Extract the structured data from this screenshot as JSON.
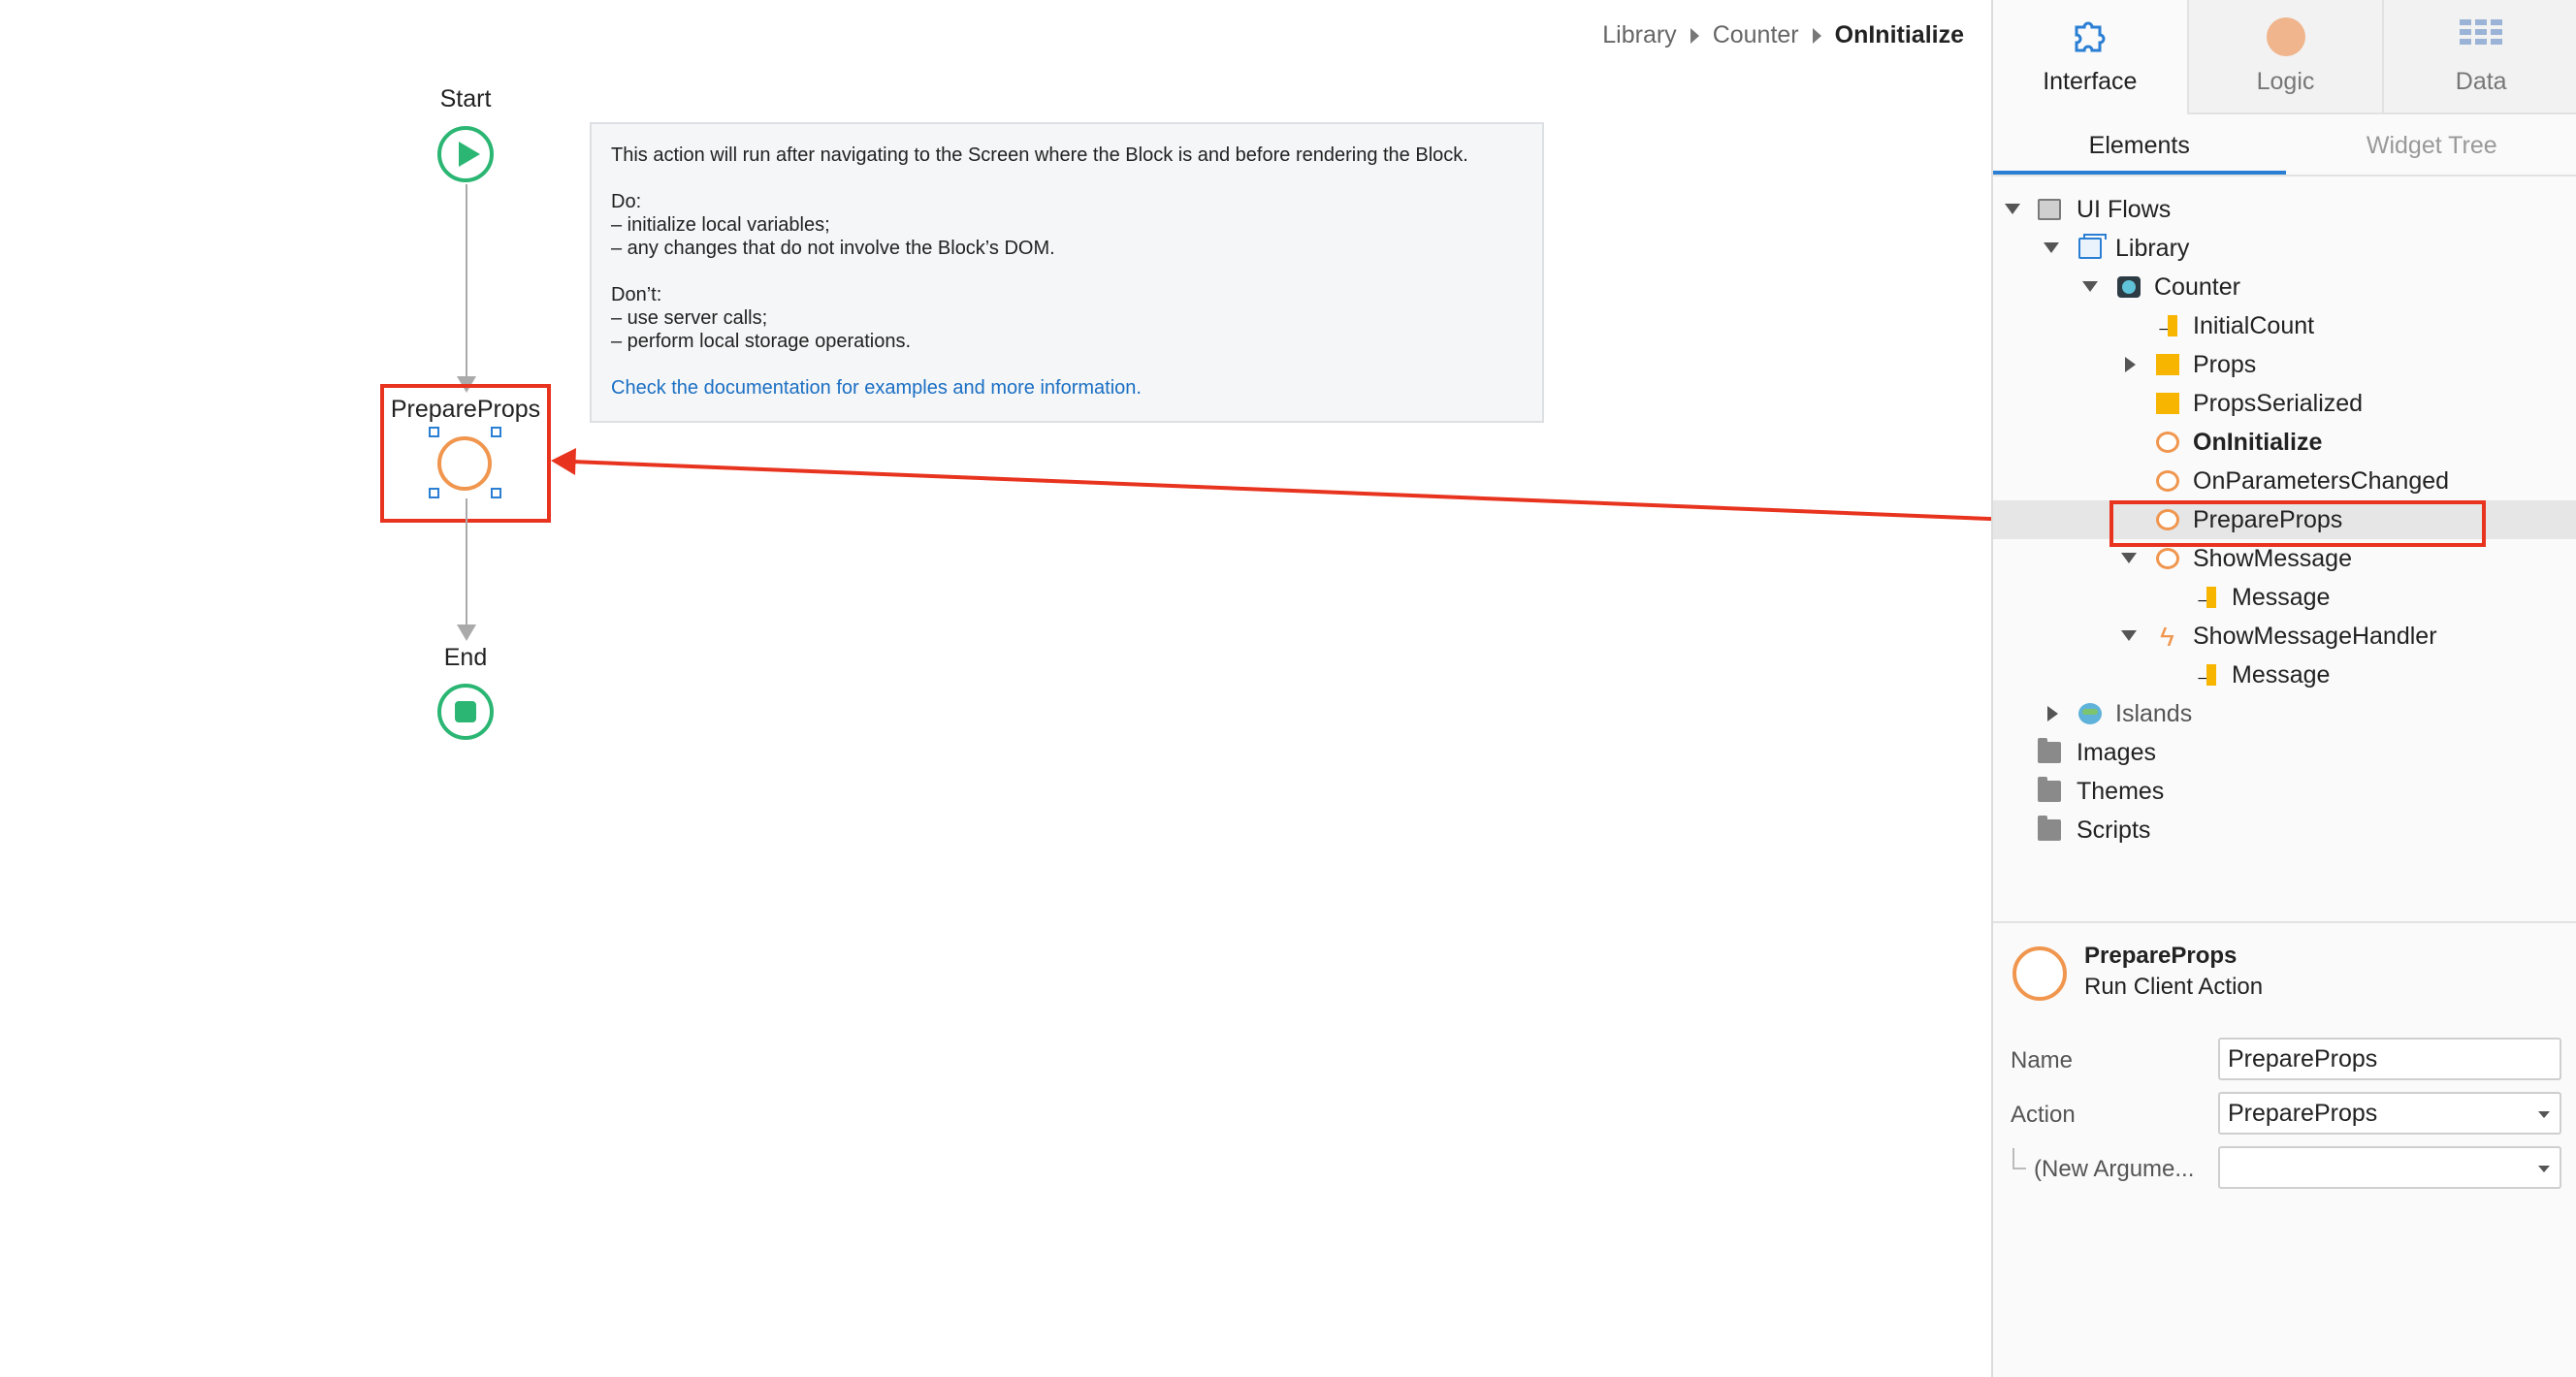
{
  "breadcrumb": {
    "items": [
      "Library",
      "Counter"
    ],
    "current": "OnInitialize"
  },
  "flow": {
    "start_label": "Start",
    "action_label": "PrepareProps",
    "end_label": "End"
  },
  "info": {
    "intro": "This action will run after navigating to the Screen where the Block is and before rendering the Block.",
    "do_title": "Do:",
    "do_items": [
      "– initialize local variables;",
      "– any changes that do not involve the Block’s DOM."
    ],
    "dont_title": "Don’t:",
    "dont_items": [
      "– use server calls;",
      "– perform local storage operations."
    ],
    "link": "Check the documentation for examples and more information."
  },
  "panel": {
    "tabs": [
      {
        "label": "Interface",
        "icon": "puzzle-icon"
      },
      {
        "label": "Logic",
        "icon": "logic-circle-icon"
      },
      {
        "label": "Data",
        "icon": "data-grid-icon"
      }
    ],
    "subtabs": [
      "Elements",
      "Widget Tree"
    ],
    "tree": [
      {
        "label": "UI Flows",
        "icon": "folder-open-icon",
        "level": 0,
        "toggle": "down"
      },
      {
        "label": "Library",
        "icon": "ui-flow-icon",
        "level": 1,
        "toggle": "down"
      },
      {
        "label": "Counter",
        "icon": "block-icon",
        "level": 2,
        "toggle": "down"
      },
      {
        "label": "InitialCount",
        "icon": "input-parameter-icon",
        "level": 3
      },
      {
        "label": "Props",
        "icon": "structure-icon",
        "level": 3,
        "toggle": "right"
      },
      {
        "label": "PropsSerialized",
        "icon": "variable-icon",
        "level": 3
      },
      {
        "label": "OnInitialize",
        "icon": "client-action-icon",
        "level": 3,
        "bold": true
      },
      {
        "label": "OnParametersChanged",
        "icon": "client-action-icon",
        "level": 3
      },
      {
        "label": "PrepareProps",
        "icon": "client-action-icon",
        "level": 3,
        "selected": true
      },
      {
        "label": "ShowMessage",
        "icon": "client-action-icon",
        "level": 3,
        "toggle": "down"
      },
      {
        "label": "Message",
        "icon": "input-parameter-icon",
        "level": 4
      },
      {
        "label": "ShowMessageHandler",
        "icon": "event-handler-icon",
        "level": 3,
        "toggle": "down"
      },
      {
        "label": "Message",
        "icon": "input-parameter-icon",
        "level": 4
      },
      {
        "label": "Islands",
        "icon": "globe-icon",
        "level": 1,
        "toggle": "right",
        "muted": true
      },
      {
        "label": "Images",
        "icon": "folder-icon",
        "level": 0
      },
      {
        "label": "Themes",
        "icon": "folder-icon",
        "level": 0
      },
      {
        "label": "Scripts",
        "icon": "folder-icon",
        "level": 0
      }
    ],
    "properties": {
      "title": "PrepareProps",
      "subtitle": "Run Client Action",
      "name_label": "Name",
      "name_value": "PrepareProps",
      "action_label": "Action",
      "action_value": "PrepareProps",
      "arg_label": "(New Argume...",
      "arg_value": ""
    }
  },
  "colors": {
    "accent_blue": "#2a7fd4",
    "flow_green": "#2bb673",
    "action_orange": "#f0964e",
    "highlight_red": "#e8331f"
  }
}
